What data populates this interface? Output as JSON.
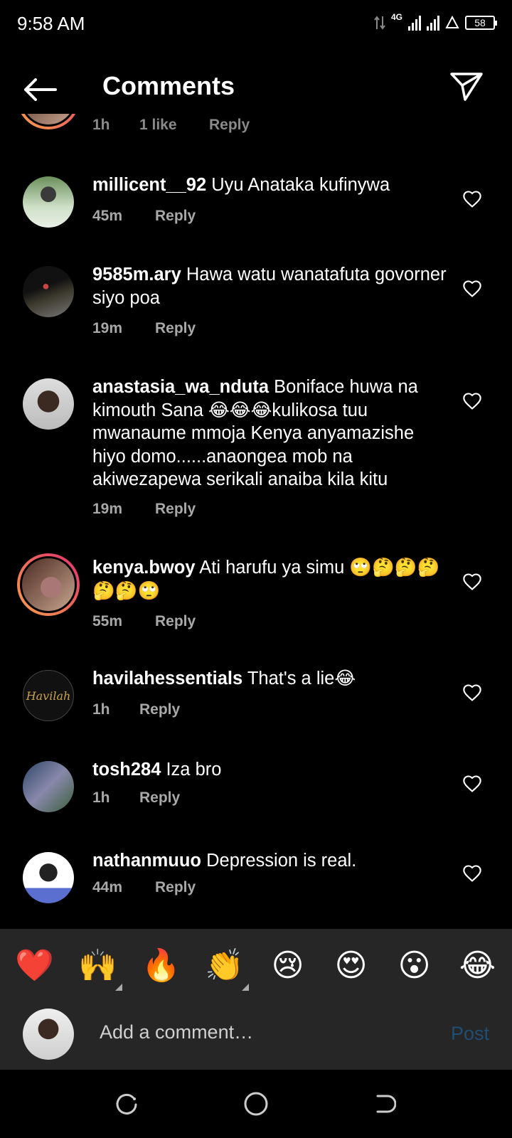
{
  "status": {
    "time": "9:58 AM",
    "network": "4G",
    "battery": "58"
  },
  "header": {
    "title": "Comments"
  },
  "partial_comment": {
    "time": "1h",
    "likes": "1 like",
    "reply": "Reply"
  },
  "comments": [
    {
      "username": "millicent__92",
      "text": "Uyu Anataka kufinywa",
      "time": "45m",
      "reply": "Reply"
    },
    {
      "username": "9585m.ary",
      "text": "Hawa watu wanatafuta govorner siyo poa",
      "time": "19m",
      "reply": "Reply"
    },
    {
      "username": "anastasia_wa_nduta",
      "text": "Boniface huwa na kimouth Sana 😂😂😂kulikosa tuu mwanaume mmoja Kenya anyamazishe hiyo domo......anaongea mob na akiwezapewa serikali anaiba kila kitu",
      "time": "19m",
      "reply": "Reply"
    },
    {
      "username": "kenya.bwoy",
      "text": "Ati harufu ya simu 🙄🤔🤔🤔🤔🤔🙄",
      "time": "55m",
      "reply": "Reply"
    },
    {
      "username": "havilahessentials",
      "text": "That's a lie😂",
      "time": "1h",
      "reply": "Reply",
      "avatar_text": "Havilah"
    },
    {
      "username": "tosh284",
      "text": "Iza bro",
      "time": "1h",
      "reply": "Reply"
    },
    {
      "username": "nathanmuuo",
      "text": "Depression is real.",
      "time": "44m",
      "reply": "Reply"
    }
  ],
  "emojis": [
    "❤️",
    "🙌",
    "🔥",
    "👏",
    "😢",
    "😍",
    "😮",
    "😂"
  ],
  "input": {
    "placeholder": "Add a comment…",
    "post_label": "Post"
  },
  "colors": {
    "background": "#000000",
    "panel": "#262626",
    "meta_text": "#a8a8a8",
    "post_disabled": "#1e4e74"
  },
  "icons": {
    "back": "back-arrow-icon",
    "send": "paper-plane-icon",
    "like": "heart-outline-icon"
  }
}
